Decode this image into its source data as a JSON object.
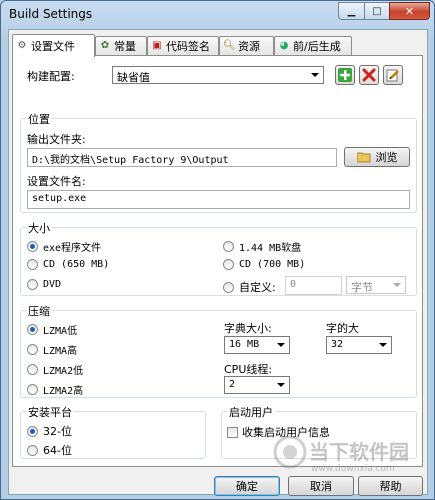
{
  "window": {
    "title": "Build Settings"
  },
  "tabs": [
    {
      "label": "设置文件"
    },
    {
      "label": "常量"
    },
    {
      "label": "代码签名"
    },
    {
      "label": "资源"
    },
    {
      "label": "前/后生成"
    }
  ],
  "config": {
    "label": "构建配置:",
    "value": "缺省值"
  },
  "location": {
    "title": "位置",
    "output_label": "输出文件夹:",
    "output_value": "D:\\我的文档\\Setup Factory 9\\Output",
    "browse_label": "浏览",
    "setup_label": "设置文件名:",
    "setup_value": "setup.exe"
  },
  "size": {
    "title": "大小",
    "options_left": [
      "exe程序文件",
      "CD (650 MB)",
      "DVD"
    ],
    "options_right": [
      "1.44 MB软盘",
      "CD (700 MB)",
      "自定义:"
    ],
    "custom_value": "0",
    "custom_unit": "字节"
  },
  "compression": {
    "title": "压缩",
    "options": [
      "LZMA低",
      "LZMA高",
      "LZMA2低",
      "LZMA2高"
    ],
    "dict_label": "字典大小:",
    "dict_value": "16 MB",
    "word_label": "字的大",
    "word_value": "32",
    "cpu_label": "CPU线程:",
    "cpu_value": "2"
  },
  "platform": {
    "title": "安装平台",
    "options": [
      "32-位",
      "64-位"
    ]
  },
  "startup": {
    "title": "启动用户",
    "collect_label": "收集启动用户信息"
  },
  "footer": {
    "ok": "确定",
    "cancel": "取消",
    "help": "帮助"
  },
  "watermark": {
    "brand": "当下软件园",
    "url": "www.downxia.com"
  },
  "colors": {
    "accent": "#1c5fb8",
    "add_green": "#2e9b2e",
    "delete_red": "#d0201a"
  }
}
